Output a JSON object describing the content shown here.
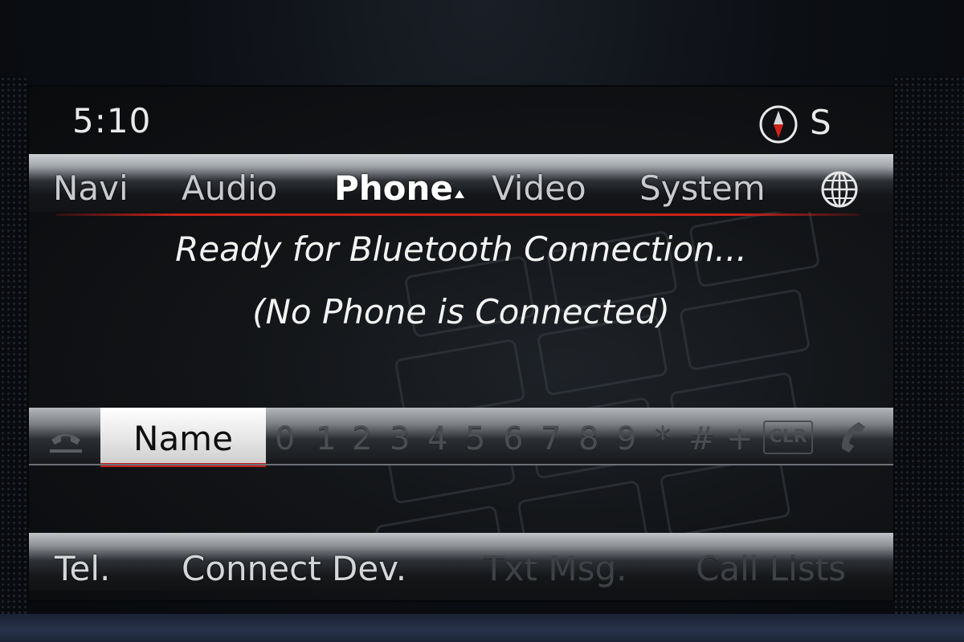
{
  "status": {
    "time": "5:10",
    "heading": "S",
    "compass_icon": "compass-icon"
  },
  "top_menu": {
    "items": [
      {
        "label": "Navi",
        "active": false
      },
      {
        "label": "Audio",
        "active": false
      },
      {
        "label": "Phone",
        "active": true
      },
      {
        "label": "Video",
        "active": false
      },
      {
        "label": "System",
        "active": false
      }
    ],
    "globe_icon": "globe-icon"
  },
  "message": {
    "line1": "Ready for Bluetooth Connection...",
    "line2": "(No Phone is Connected)"
  },
  "dial_bar": {
    "phonebook_icon": "phonebook-icon",
    "selected": "Name",
    "characters": [
      "0",
      "1",
      "2",
      "3",
      "4",
      "5",
      "6",
      "7",
      "8",
      "9",
      "*",
      "#",
      "+"
    ],
    "clear_label": "CLR",
    "call_icon": "handset-icon"
  },
  "bottom_menu": {
    "items": [
      {
        "label": "Tel.",
        "enabled": true
      },
      {
        "label": "Connect Dev.",
        "enabled": true
      },
      {
        "label": "Txt Msg.",
        "enabled": false
      },
      {
        "label": "Call Lists",
        "enabled": false
      }
    ]
  },
  "colors": {
    "accent_red": "#c8221c",
    "text_white": "#f3f3f3",
    "disabled_text": "#3e4145"
  }
}
